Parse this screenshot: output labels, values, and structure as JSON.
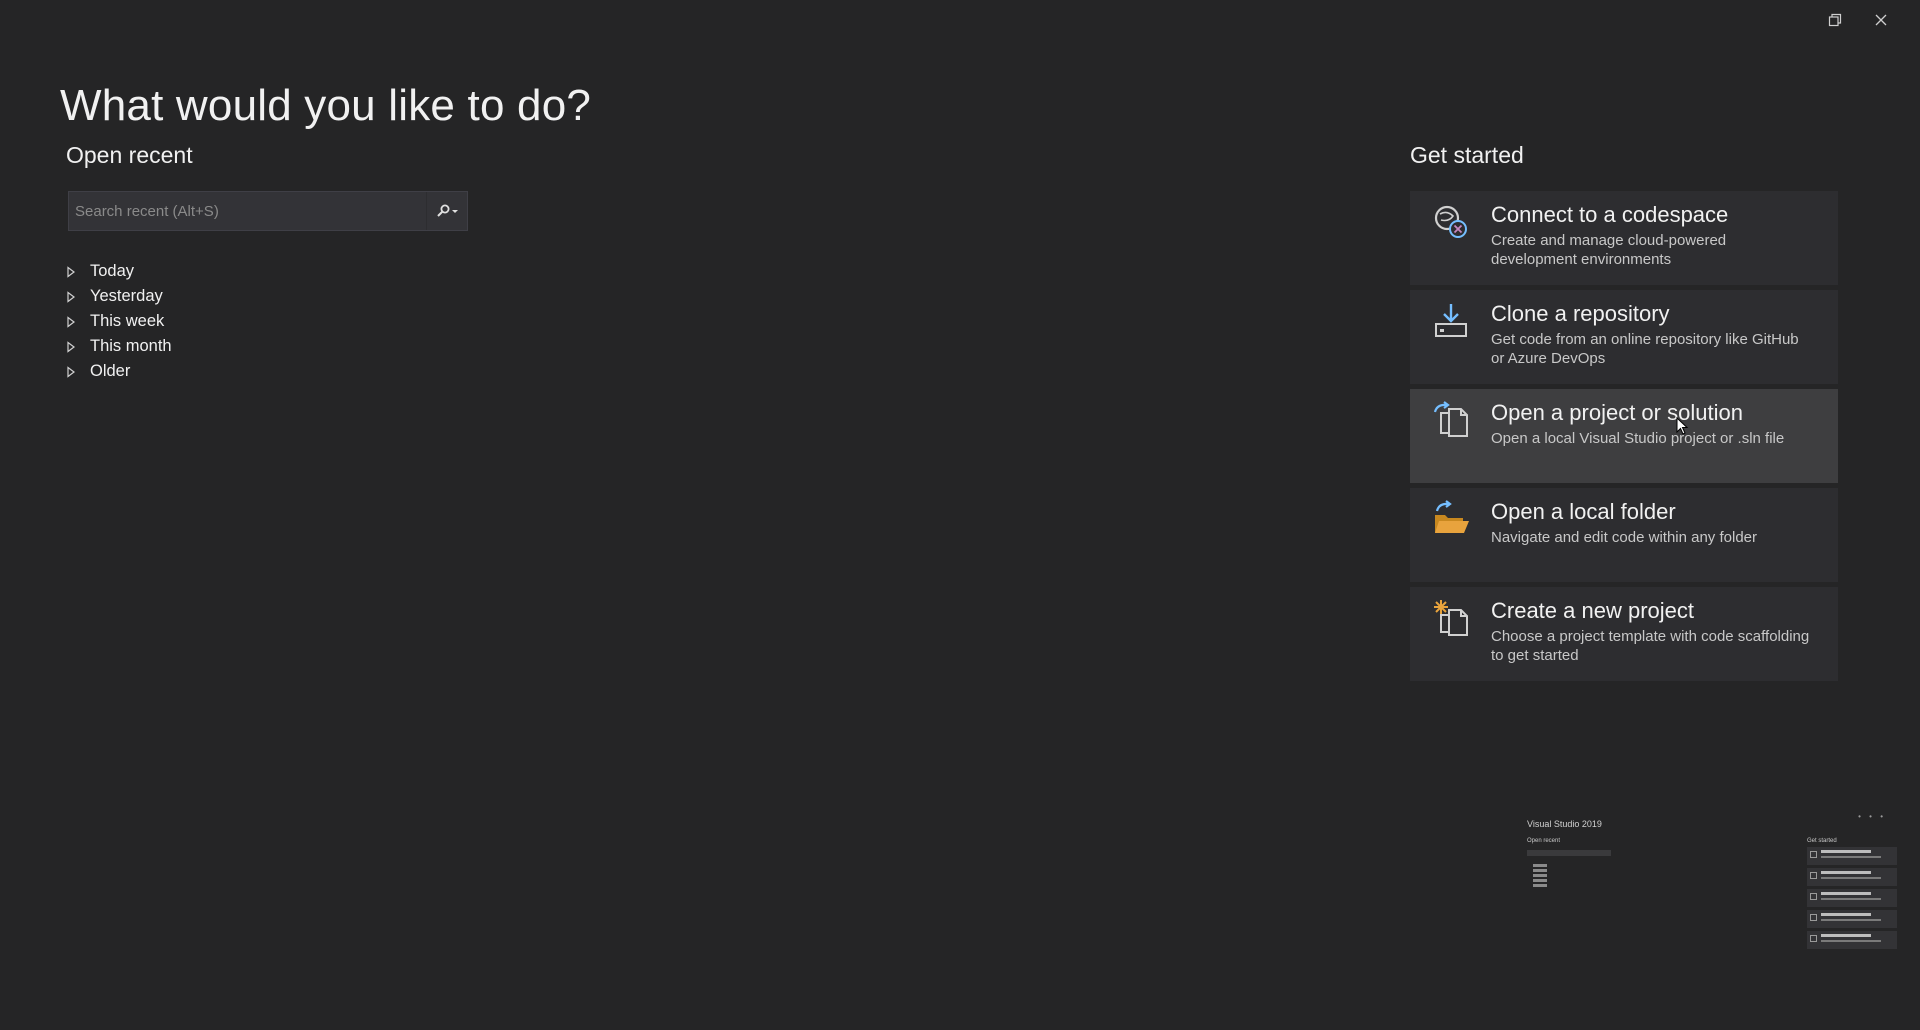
{
  "window": {
    "restore_icon": "restore-icon",
    "close_icon": "close-icon"
  },
  "page": {
    "title": "What would you like to do?"
  },
  "recent": {
    "heading": "Open recent",
    "search_placeholder": "Search recent (Alt+S)",
    "groups": [
      "Today",
      "Yesterday",
      "This week",
      "This month",
      "Older"
    ]
  },
  "started": {
    "heading": "Get started",
    "cards": [
      {
        "title": "Connect to a codespace",
        "desc_line1": "Create and manage cloud-powered",
        "desc_line2": "development environments",
        "icon": "codespace-icon"
      },
      {
        "title": "Clone a repository",
        "desc_line1": "Get code from an online repository like GitHub",
        "desc_line2": "or Azure DevOps",
        "icon": "clone-icon"
      },
      {
        "title": "Open a project or solution",
        "desc_line1": "Open a local Visual Studio project or .sln file",
        "desc_line2": "",
        "icon": "open-project-icon"
      },
      {
        "title": "Open a local folder",
        "desc_line1": "Navigate and edit code within any folder",
        "desc_line2": "",
        "icon": "folder-icon"
      },
      {
        "title": "Create a new project",
        "desc_line1": "Choose a project template with code scaffolding",
        "desc_line2": "to get started",
        "icon": "new-project-icon"
      }
    ]
  },
  "thumbnail": {
    "title": "Visual Studio 2019"
  },
  "colors": {
    "background": "#252526",
    "card": "#2d2d30",
    "card_hover": "#3e3e40",
    "accent_blue": "#75beff",
    "accent_orange": "#e8a33d"
  }
}
